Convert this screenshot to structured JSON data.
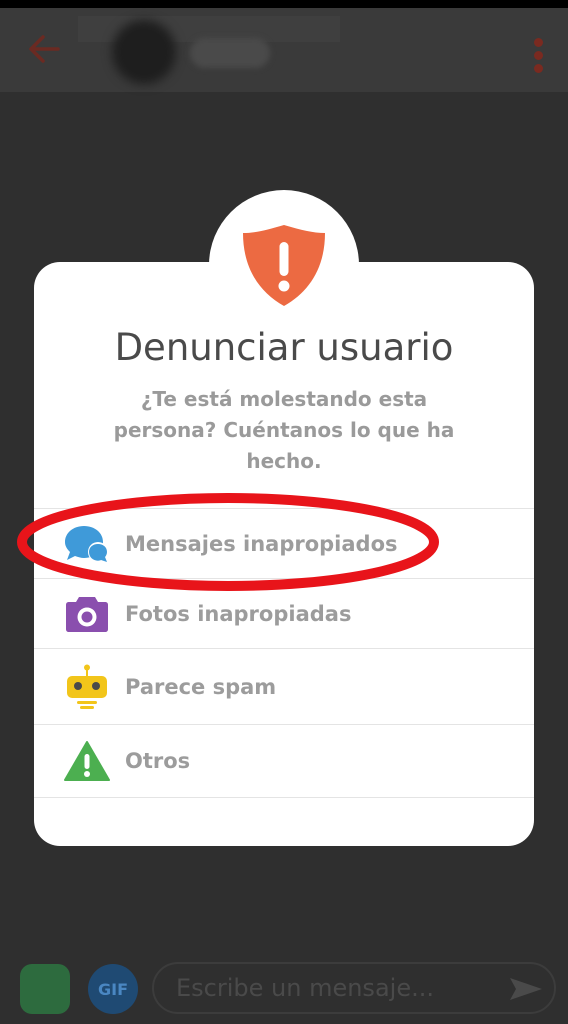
{
  "background": {
    "composer_placeholder": "Escribe un mensaje...",
    "gif_label": "GIF"
  },
  "dialog": {
    "title": "Denunciar usuario",
    "subtitle": "¿Te está molestando esta persona? Cuéntanos lo que ha hecho.",
    "options": [
      {
        "label": "Mensajes inapropiados",
        "icon": "chat-bubbles-icon",
        "color": "#3f9ad9"
      },
      {
        "label": "Fotos inapropiadas",
        "icon": "camera-icon",
        "color": "#8a4fae"
      },
      {
        "label": "Parece spam",
        "icon": "robot-icon",
        "color": "#f2c51a"
      },
      {
        "label": "Otros",
        "icon": "warning-icon",
        "color": "#4caf50"
      }
    ],
    "shield_color": "#ec6a42",
    "highlight_color": "#e8141a"
  }
}
